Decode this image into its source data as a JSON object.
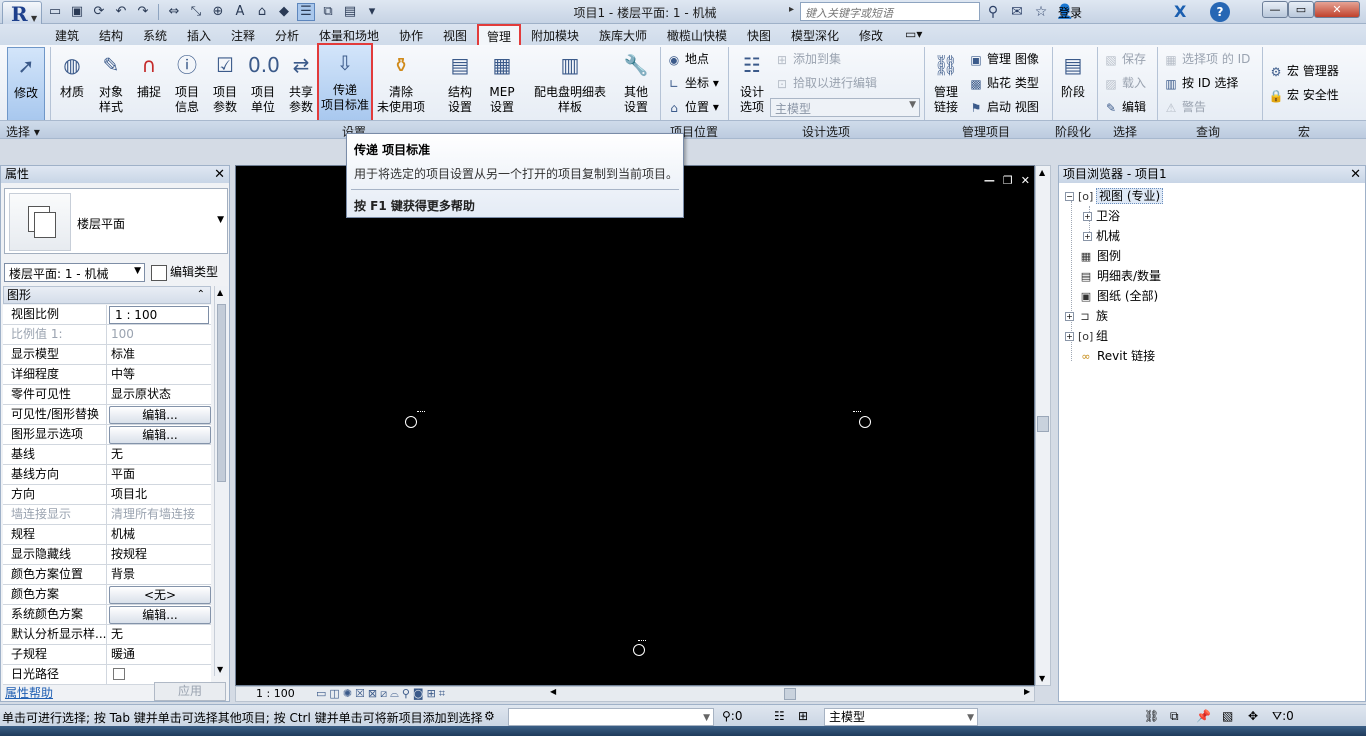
{
  "window": {
    "title": "项目1 - 楼层平面: 1 - 机械",
    "search_placeholder": "键入关键字或短语",
    "login_label": "登录",
    "help_label": "?",
    "x_label": "X"
  },
  "app_button": {
    "letter": "R"
  },
  "tabs": [
    {
      "label": "建筑"
    },
    {
      "label": "结构"
    },
    {
      "label": "系统"
    },
    {
      "label": "插入"
    },
    {
      "label": "注释"
    },
    {
      "label": "分析"
    },
    {
      "label": "体量和场地"
    },
    {
      "label": "协作"
    },
    {
      "label": "视图"
    },
    {
      "label": "管理"
    },
    {
      "label": "附加模块"
    },
    {
      "label": "族库大师"
    },
    {
      "label": "橄榄山快模"
    },
    {
      "label": "快图"
    },
    {
      "label": "模型深化"
    },
    {
      "label": "修改"
    }
  ],
  "ribbon": {
    "modify": {
      "label": "修改"
    },
    "large_buttons": [
      {
        "l1": "材质",
        "l2": ""
      },
      {
        "l1": "对象",
        "l2": "样式"
      },
      {
        "l1": "捕捉",
        "l2": ""
      },
      {
        "l1": "项目",
        "l2": "信息"
      },
      {
        "l1": "项目",
        "l2": "参数"
      },
      {
        "l1": "项目",
        "l2": "单位"
      },
      {
        "l1": "共享",
        "l2": "参数"
      },
      {
        "l1": "传递",
        "l2": "项目标准"
      },
      {
        "l1": "清除",
        "l2": "未使用项"
      },
      {
        "l1": "结构",
        "l2": "设置"
      },
      {
        "l1": "MEP",
        "l2": "设置"
      },
      {
        "l1": "配电盘明细表",
        "l2": "样板"
      },
      {
        "l1": "其他",
        "l2": "设置"
      }
    ],
    "location": [
      {
        "label": "地点"
      },
      {
        "label": "坐标"
      },
      {
        "label": "位置"
      }
    ],
    "design_options": {
      "btn_l1": "设计",
      "btn_l2": "选项",
      "add_to_set": "添加到集",
      "pick_to_edit": "拾取以进行编辑",
      "main_model": "主模型"
    },
    "manage_project": {
      "btn_l1": "管理",
      "btn_l2": "链接",
      "manage_images": "管理 图像",
      "decal_types": "贴花 类型",
      "starting_view": "启动 视图"
    },
    "phasing": {
      "label": "阶段"
    },
    "selection": {
      "save": "保存",
      "load": "载入",
      "edit": "编辑"
    },
    "inquiry": {
      "ids": "选择项 的 ID",
      "select_by_id": "按 ID 选择",
      "warnings": "警告"
    },
    "macros": {
      "manager": "宏 管理器",
      "security": "宏 安全性"
    },
    "panel_labels": {
      "select": "选择",
      "settings": "设置",
      "project_location": "项目位置",
      "design_options": "设计选项",
      "manage_project": "管理项目",
      "phasing": "阶段化",
      "selection": "选择",
      "inquiry": "查询",
      "macros": "宏"
    }
  },
  "tooltip": {
    "title": "传递 项目标准",
    "description": "用于将选定的项目设置从另一个打开的项目复制到当前项目。",
    "help": "按 F1 键获得更多帮助"
  },
  "properties": {
    "title": "属性",
    "type_name": "楼层平面",
    "instance": "楼层平面: 1 - 机械",
    "edit_type": "编辑类型",
    "group": "图形",
    "rows": [
      {
        "name": "视图比例",
        "value": "1 : 100"
      },
      {
        "name": "比例值 1:",
        "value": "100"
      },
      {
        "name": "显示模型",
        "value": "标准"
      },
      {
        "name": "详细程度",
        "value": "中等"
      },
      {
        "name": "零件可见性",
        "value": "显示原状态"
      },
      {
        "name": "可见性/图形替换",
        "value": "编辑..."
      },
      {
        "name": "图形显示选项",
        "value": "编辑..."
      },
      {
        "name": "基线",
        "value": "无"
      },
      {
        "name": "基线方向",
        "value": "平面"
      },
      {
        "name": "方向",
        "value": "项目北"
      },
      {
        "name": "墙连接显示",
        "value": "清理所有墙连接"
      },
      {
        "name": "规程",
        "value": "机械"
      },
      {
        "name": "显示隐藏线",
        "value": "按规程"
      },
      {
        "name": "颜色方案位置",
        "value": "背景"
      },
      {
        "name": "颜色方案",
        "value": "<无>"
      },
      {
        "name": "系统颜色方案",
        "value": "编辑..."
      },
      {
        "name": "默认分析显示样...",
        "value": "无"
      },
      {
        "name": "子规程",
        "value": "暖通"
      },
      {
        "name": "日光路径",
        "value": ""
      }
    ],
    "help_link": "属性帮助",
    "apply": "应用"
  },
  "view_bar": {
    "scale": "1 : 100"
  },
  "browser": {
    "title": "项目浏览器 - 项目1",
    "nodes": {
      "views": "视图 (专业)",
      "plumbing": "卫浴",
      "mechanical": "机械",
      "legends": "图例",
      "schedules": "明细表/数量",
      "sheets": "图纸 (全部)",
      "families": "族",
      "groups": "组",
      "revit_links": "Revit 链接"
    }
  },
  "status": {
    "text": "单击可进行选择; 按 Tab 键并单击可选择其他项目; 按 Ctrl 键并单击可将新项目添加到选择",
    "count_left": ":0",
    "main_model": "主模型",
    "count_right": ":0"
  }
}
